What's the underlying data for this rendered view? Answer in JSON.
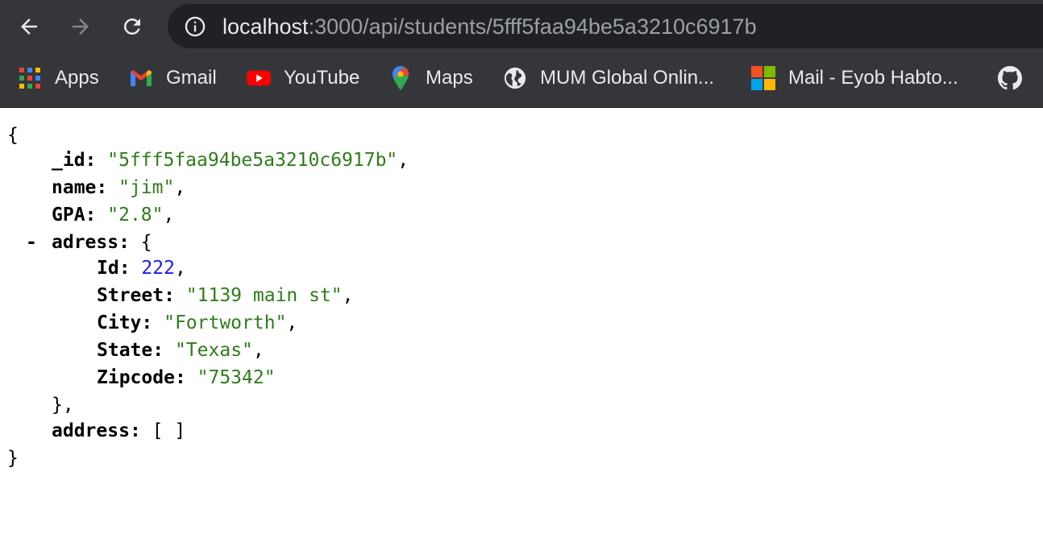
{
  "browser": {
    "url_host": "localhost",
    "url_path": ":3000/api/students/5fff5faa94be5a3210c6917b",
    "bookmarks": [
      {
        "label": "Apps",
        "icon": "apps-grid-icon"
      },
      {
        "label": "Gmail",
        "icon": "gmail-icon"
      },
      {
        "label": "YouTube",
        "icon": "youtube-icon"
      },
      {
        "label": "Maps",
        "icon": "maps-icon"
      },
      {
        "label": "MUM Global Onlin...",
        "icon": "globe-icon"
      },
      {
        "label": "Mail - Eyob Habto...",
        "icon": "microsoft-icon"
      },
      {
        "label": "",
        "icon": "github-icon"
      }
    ]
  },
  "json": {
    "open_brace": "{",
    "close_brace": "}",
    "toggle": "-",
    "id_key": "_id",
    "id_value": "\"5fff5faa94be5a3210c6917b\"",
    "name_key": "name",
    "name_value": "\"jim\"",
    "gpa_key": "GPA",
    "gpa_value": "\"2.8\"",
    "adress_key": "adress",
    "adress_open": "{",
    "adress_close": "},",
    "addr_id_key": "Id",
    "addr_id_value": "222",
    "street_key": "Street",
    "street_value": "\"1139 main st\"",
    "city_key": "City",
    "city_value": "\"Fortworth\"",
    "state_key": "State",
    "state_value": "\"Texas\"",
    "zip_key": "Zipcode",
    "zip_value": "\"75342\"",
    "address_key": "address",
    "address_value": "[ ]"
  },
  "colors": {
    "chrome": "#35363a",
    "omnibox": "#202124",
    "string": "#2e7d1a",
    "number": "#1a1aff"
  }
}
